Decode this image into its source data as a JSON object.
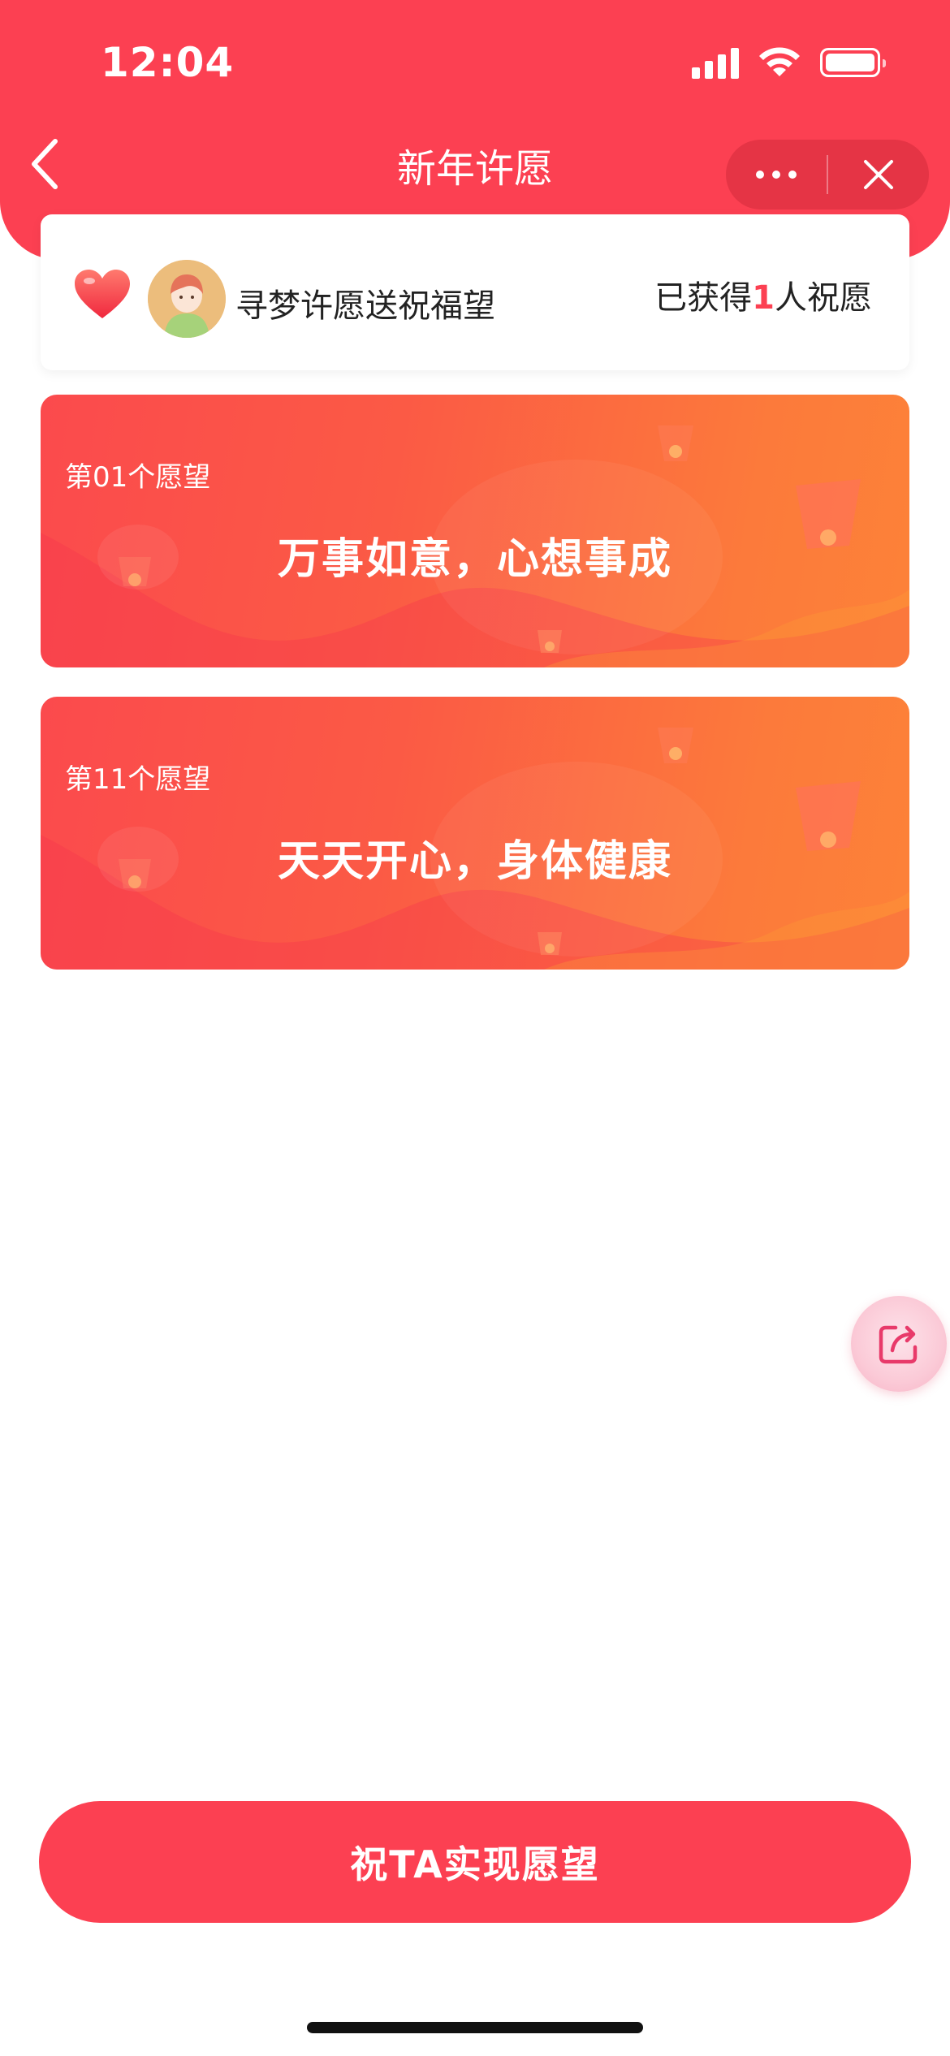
{
  "status_bar": {
    "time": "12:04"
  },
  "nav": {
    "title": "新年许愿"
  },
  "info": {
    "name": "寻梦许愿送祝福望",
    "count_prefix": "已获得",
    "count": "1",
    "count_suffix": "人祝愿"
  },
  "wishes": [
    {
      "number_label": "第01个愿望",
      "text": "万事如意，心想事成"
    },
    {
      "number_label": "第11个愿望",
      "text": "天天开心，身体健康"
    }
  ],
  "cta": {
    "label": "祝TA实现愿望"
  },
  "colors": {
    "brand_red": "#fc4052",
    "card_orange": "#fd8238"
  },
  "icons": [
    "back-chevron-icon",
    "more-dots-icon",
    "close-icon",
    "heart-icon",
    "avatar",
    "share-icon"
  ]
}
